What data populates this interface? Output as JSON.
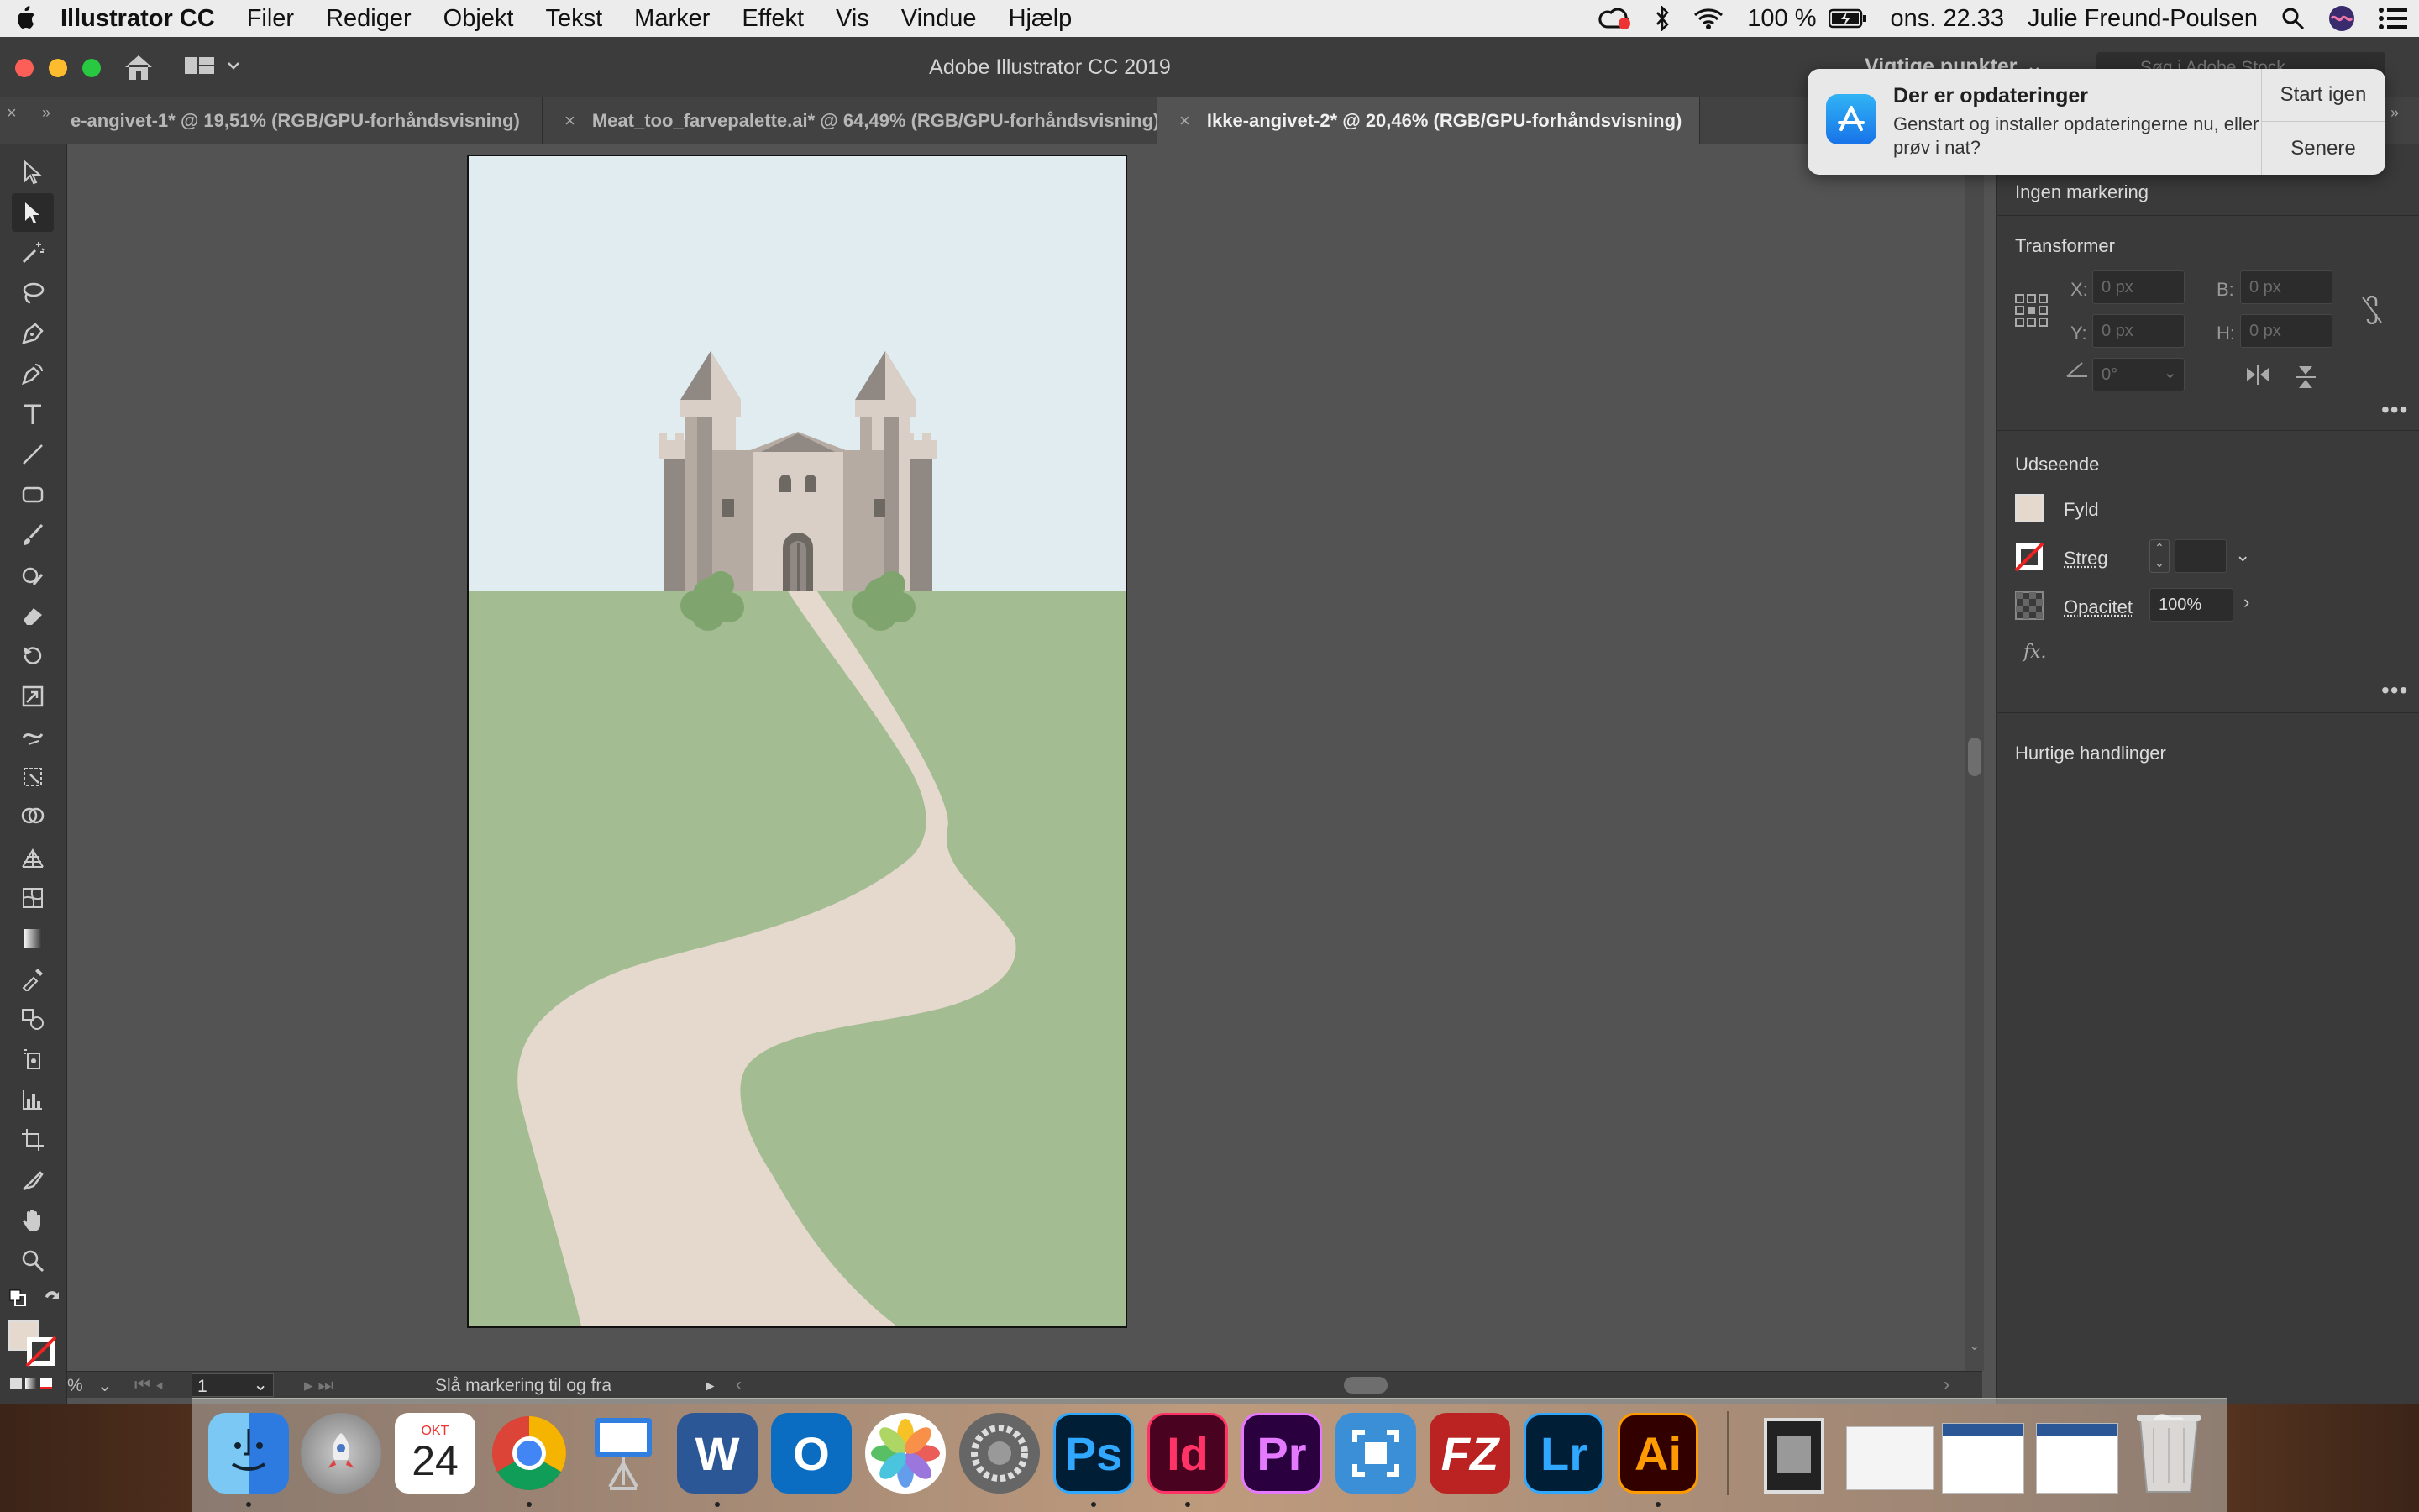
{
  "menubar": {
    "app_name": "Illustrator CC",
    "items": [
      "Filer",
      "Rediger",
      "Objekt",
      "Tekst",
      "Marker",
      "Effekt",
      "Vis",
      "Vindue",
      "Hjælp"
    ],
    "battery": "100 %",
    "clock": "ons. 22.33",
    "user": "Julie Freund-Poulsen"
  },
  "window": {
    "title": "Adobe Illustrator CC 2019",
    "workspace": "Vigtige punkter",
    "stock_search_placeholder": "Søg i Adobe Stock"
  },
  "tabs": [
    {
      "label": "e-angivet-1* @ 19,51% (RGB/GPU-forhåndsvisning)",
      "active": false
    },
    {
      "label": "Meat_too_farvepalette.ai* @ 64,49% (RGB/GPU-forhåndsvisning)",
      "active": false
    },
    {
      "label": "Ikke-angivet-2* @ 20,46% (RGB/GPU-forhåndsvisning)",
      "active": true
    }
  ],
  "notification": {
    "title": "Der er opdateringer",
    "body": "Genstart og installer opdateringerne nu, eller prøv i nat?",
    "primary": "Start igen",
    "secondary": "Senere"
  },
  "properties": {
    "selection": "Ingen markering",
    "transform_title": "Transformer",
    "x_label": "X:",
    "x_value": "0 px",
    "y_label": "Y:",
    "y_value": "0 px",
    "w_label": "B:",
    "w_value": "0 px",
    "h_label": "H:",
    "h_value": "0 px",
    "angle_value": "0°",
    "appearance_title": "Udseende",
    "fill_label": "Fyld",
    "stroke_label": "Streg",
    "opacity_label": "Opacitet",
    "opacity_value": "100%",
    "fx_label": "fx.",
    "quick_actions_title": "Hurtige handlinger"
  },
  "statusbar": {
    "zoom": "%",
    "artboard_number": "1",
    "status_text": "Slå markering til og fra"
  },
  "dock": {
    "calendar_month": "OKT",
    "calendar_day": "24",
    "apps": [
      "Finder",
      "Launchpad",
      "Kalender",
      "Chrome",
      "Keynote",
      "Word",
      "Outlook",
      "Fotos",
      "Systemindstillinger",
      "Ps",
      "Id",
      "Pr",
      "Scanner",
      "FileZilla",
      "Lr",
      "Ai"
    ]
  },
  "colors": {
    "sky": "#e0ecef",
    "grass": "#a3bc92",
    "path": "#e5d8cc",
    "castle_light": "#d9cfc6",
    "castle_mid": "#b5aba3",
    "castle_dark": "#8f8883",
    "bush": "#7fa46e"
  }
}
